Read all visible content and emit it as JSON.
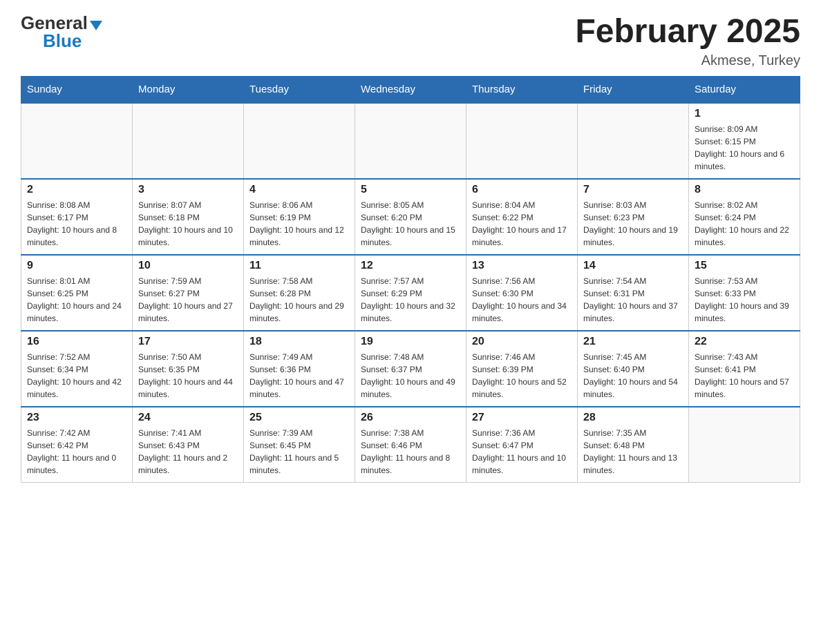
{
  "logo": {
    "general": "General",
    "blue": "Blue",
    "triangle": "▼"
  },
  "title": "February 2025",
  "subtitle": "Akmese, Turkey",
  "days": {
    "headers": [
      "Sunday",
      "Monday",
      "Tuesday",
      "Wednesday",
      "Thursday",
      "Friday",
      "Saturday"
    ]
  },
  "weeks": [
    [
      {
        "day": "",
        "info": ""
      },
      {
        "day": "",
        "info": ""
      },
      {
        "day": "",
        "info": ""
      },
      {
        "day": "",
        "info": ""
      },
      {
        "day": "",
        "info": ""
      },
      {
        "day": "",
        "info": ""
      },
      {
        "day": "1",
        "info": "Sunrise: 8:09 AM\nSunset: 6:15 PM\nDaylight: 10 hours and 6 minutes."
      }
    ],
    [
      {
        "day": "2",
        "info": "Sunrise: 8:08 AM\nSunset: 6:17 PM\nDaylight: 10 hours and 8 minutes."
      },
      {
        "day": "3",
        "info": "Sunrise: 8:07 AM\nSunset: 6:18 PM\nDaylight: 10 hours and 10 minutes."
      },
      {
        "day": "4",
        "info": "Sunrise: 8:06 AM\nSunset: 6:19 PM\nDaylight: 10 hours and 12 minutes."
      },
      {
        "day": "5",
        "info": "Sunrise: 8:05 AM\nSunset: 6:20 PM\nDaylight: 10 hours and 15 minutes."
      },
      {
        "day": "6",
        "info": "Sunrise: 8:04 AM\nSunset: 6:22 PM\nDaylight: 10 hours and 17 minutes."
      },
      {
        "day": "7",
        "info": "Sunrise: 8:03 AM\nSunset: 6:23 PM\nDaylight: 10 hours and 19 minutes."
      },
      {
        "day": "8",
        "info": "Sunrise: 8:02 AM\nSunset: 6:24 PM\nDaylight: 10 hours and 22 minutes."
      }
    ],
    [
      {
        "day": "9",
        "info": "Sunrise: 8:01 AM\nSunset: 6:25 PM\nDaylight: 10 hours and 24 minutes."
      },
      {
        "day": "10",
        "info": "Sunrise: 7:59 AM\nSunset: 6:27 PM\nDaylight: 10 hours and 27 minutes."
      },
      {
        "day": "11",
        "info": "Sunrise: 7:58 AM\nSunset: 6:28 PM\nDaylight: 10 hours and 29 minutes."
      },
      {
        "day": "12",
        "info": "Sunrise: 7:57 AM\nSunset: 6:29 PM\nDaylight: 10 hours and 32 minutes."
      },
      {
        "day": "13",
        "info": "Sunrise: 7:56 AM\nSunset: 6:30 PM\nDaylight: 10 hours and 34 minutes."
      },
      {
        "day": "14",
        "info": "Sunrise: 7:54 AM\nSunset: 6:31 PM\nDaylight: 10 hours and 37 minutes."
      },
      {
        "day": "15",
        "info": "Sunrise: 7:53 AM\nSunset: 6:33 PM\nDaylight: 10 hours and 39 minutes."
      }
    ],
    [
      {
        "day": "16",
        "info": "Sunrise: 7:52 AM\nSunset: 6:34 PM\nDaylight: 10 hours and 42 minutes."
      },
      {
        "day": "17",
        "info": "Sunrise: 7:50 AM\nSunset: 6:35 PM\nDaylight: 10 hours and 44 minutes."
      },
      {
        "day": "18",
        "info": "Sunrise: 7:49 AM\nSunset: 6:36 PM\nDaylight: 10 hours and 47 minutes."
      },
      {
        "day": "19",
        "info": "Sunrise: 7:48 AM\nSunset: 6:37 PM\nDaylight: 10 hours and 49 minutes."
      },
      {
        "day": "20",
        "info": "Sunrise: 7:46 AM\nSunset: 6:39 PM\nDaylight: 10 hours and 52 minutes."
      },
      {
        "day": "21",
        "info": "Sunrise: 7:45 AM\nSunset: 6:40 PM\nDaylight: 10 hours and 54 minutes."
      },
      {
        "day": "22",
        "info": "Sunrise: 7:43 AM\nSunset: 6:41 PM\nDaylight: 10 hours and 57 minutes."
      }
    ],
    [
      {
        "day": "23",
        "info": "Sunrise: 7:42 AM\nSunset: 6:42 PM\nDaylight: 11 hours and 0 minutes."
      },
      {
        "day": "24",
        "info": "Sunrise: 7:41 AM\nSunset: 6:43 PM\nDaylight: 11 hours and 2 minutes."
      },
      {
        "day": "25",
        "info": "Sunrise: 7:39 AM\nSunset: 6:45 PM\nDaylight: 11 hours and 5 minutes."
      },
      {
        "day": "26",
        "info": "Sunrise: 7:38 AM\nSunset: 6:46 PM\nDaylight: 11 hours and 8 minutes."
      },
      {
        "day": "27",
        "info": "Sunrise: 7:36 AM\nSunset: 6:47 PM\nDaylight: 11 hours and 10 minutes."
      },
      {
        "day": "28",
        "info": "Sunrise: 7:35 AM\nSunset: 6:48 PM\nDaylight: 11 hours and 13 minutes."
      },
      {
        "day": "",
        "info": ""
      }
    ]
  ]
}
